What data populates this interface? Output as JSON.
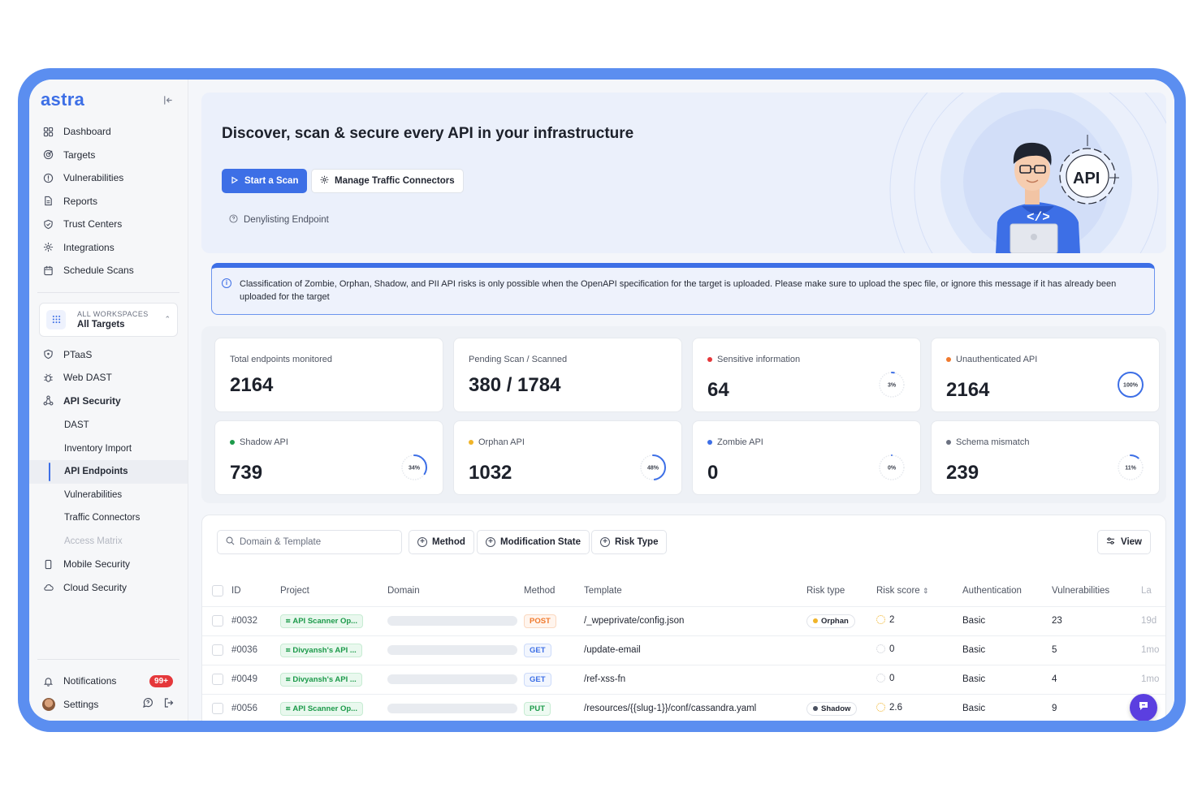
{
  "brand": {
    "logo": "astra",
    "accent": "#3d6fe6",
    "frame": "#5b8ef0"
  },
  "sidebar": {
    "nav": [
      {
        "label": "Dashboard",
        "icon": "grid-icon"
      },
      {
        "label": "Targets",
        "icon": "target-icon"
      },
      {
        "label": "Vulnerabilities",
        "icon": "alert-circle-icon"
      },
      {
        "label": "Reports",
        "icon": "file-icon"
      },
      {
        "label": "Trust Centers",
        "icon": "shield-check-icon"
      },
      {
        "label": "Integrations",
        "icon": "puzzle-icon"
      },
      {
        "label": "Schedule Scans",
        "icon": "calendar-icon"
      }
    ],
    "workspace": {
      "label": "ALL WORKSPACES",
      "value": "All Targets"
    },
    "products": [
      {
        "label": "PTaaS",
        "icon": "shield-icon"
      },
      {
        "label": "Web DAST",
        "icon": "bug-icon"
      },
      {
        "label": "API Security",
        "icon": "api-nodes-icon"
      }
    ],
    "api_sub": [
      {
        "label": "DAST",
        "state": "normal"
      },
      {
        "label": "Inventory Import",
        "state": "normal"
      },
      {
        "label": "API Endpoints",
        "state": "active"
      },
      {
        "label": "Vulnerabilities",
        "state": "normal"
      },
      {
        "label": "Traffic Connectors",
        "state": "normal"
      },
      {
        "label": "Access Matrix",
        "state": "disabled"
      }
    ],
    "more": [
      {
        "label": "Mobile Security",
        "icon": "mobile-icon"
      },
      {
        "label": "Cloud Security",
        "icon": "cloud-icon"
      }
    ],
    "notifications": {
      "label": "Notifications",
      "badge": "99+"
    },
    "settings": {
      "label": "Settings"
    }
  },
  "hero": {
    "title": "Discover, scan & secure every API in your infrastructure",
    "primary_button": "Start a Scan",
    "secondary_button": "Manage Traffic Connectors",
    "link": "Denylisting Endpoint",
    "illustration_text": "API",
    "code_glyph": "</>"
  },
  "banner": {
    "text": "Classification of Zombie, Orphan, Shadow, and PII API risks is only possible when the OpenAPI specification for the target is uploaded. Please make sure to upload the spec file, or ignore this message if it has already been uploaded for the target"
  },
  "stats": [
    {
      "label": "Total endpoints monitored",
      "value": "2164",
      "dot": null,
      "percent": null
    },
    {
      "label": "Pending Scan / Scanned",
      "value": "380 / 1784",
      "dot": null,
      "percent": null
    },
    {
      "label": "Sensitive information",
      "value": "64",
      "dot": "#e5383b",
      "percent": 3,
      "percent_label": "3%"
    },
    {
      "label": "Unauthenticated API",
      "value": "2164",
      "dot": "#f07a2e",
      "percent": 100,
      "percent_label": "100%"
    },
    {
      "label": "Shadow API",
      "value": "739",
      "dot": "#1c9a4a",
      "percent": 34,
      "percent_label": "34%"
    },
    {
      "label": "Orphan API",
      "value": "1032",
      "dot": "#f0b429",
      "percent": 48,
      "percent_label": "48%"
    },
    {
      "label": "Zombie API",
      "value": "0",
      "dot": "#3d6fe6",
      "percent": 0,
      "percent_label": "0%"
    },
    {
      "label": "Schema mismatch",
      "value": "239",
      "dot": "#6b7180",
      "percent": 11,
      "percent_label": "11%"
    }
  ],
  "toolbar": {
    "search_placeholder": "Domain & Template",
    "filters": [
      "Method",
      "Modification State",
      "Risk Type"
    ],
    "view_label": "View"
  },
  "table": {
    "columns": [
      "ID",
      "Project",
      "Domain",
      "Method",
      "Template",
      "Risk type",
      "Risk score",
      "Authentication",
      "Vulnerabilities",
      "La"
    ],
    "rows": [
      {
        "id": "#0032",
        "project": "API Scanner Op...",
        "method": "POST",
        "template": "/_wpeprivate/config.json",
        "risk_type": "Orphan",
        "risk_dot": "#f0b429",
        "risk_score": "2",
        "auth": "Basic",
        "vulns": "23",
        "last": "19d"
      },
      {
        "id": "#0036",
        "project": "Divyansh's API ...",
        "method": "GET",
        "template": "/update-email",
        "risk_type": "",
        "risk_dot": null,
        "risk_score": "0",
        "auth": "Basic",
        "vulns": "5",
        "last": "1mo"
      },
      {
        "id": "#0049",
        "project": "Divyansh's API ...",
        "method": "GET",
        "template": "/ref-xss-fn",
        "risk_type": "",
        "risk_dot": null,
        "risk_score": "0",
        "auth": "Basic",
        "vulns": "4",
        "last": "1mo"
      },
      {
        "id": "#0056",
        "project": "API Scanner Op...",
        "method": "PUT",
        "template": "/resources/{{slug-1}}/conf/cassandra.yaml",
        "risk_type": "Shadow",
        "risk_dot": "#4a5060",
        "risk_score": "2.6",
        "auth": "Basic",
        "vulns": "9",
        "last": ""
      }
    ]
  }
}
